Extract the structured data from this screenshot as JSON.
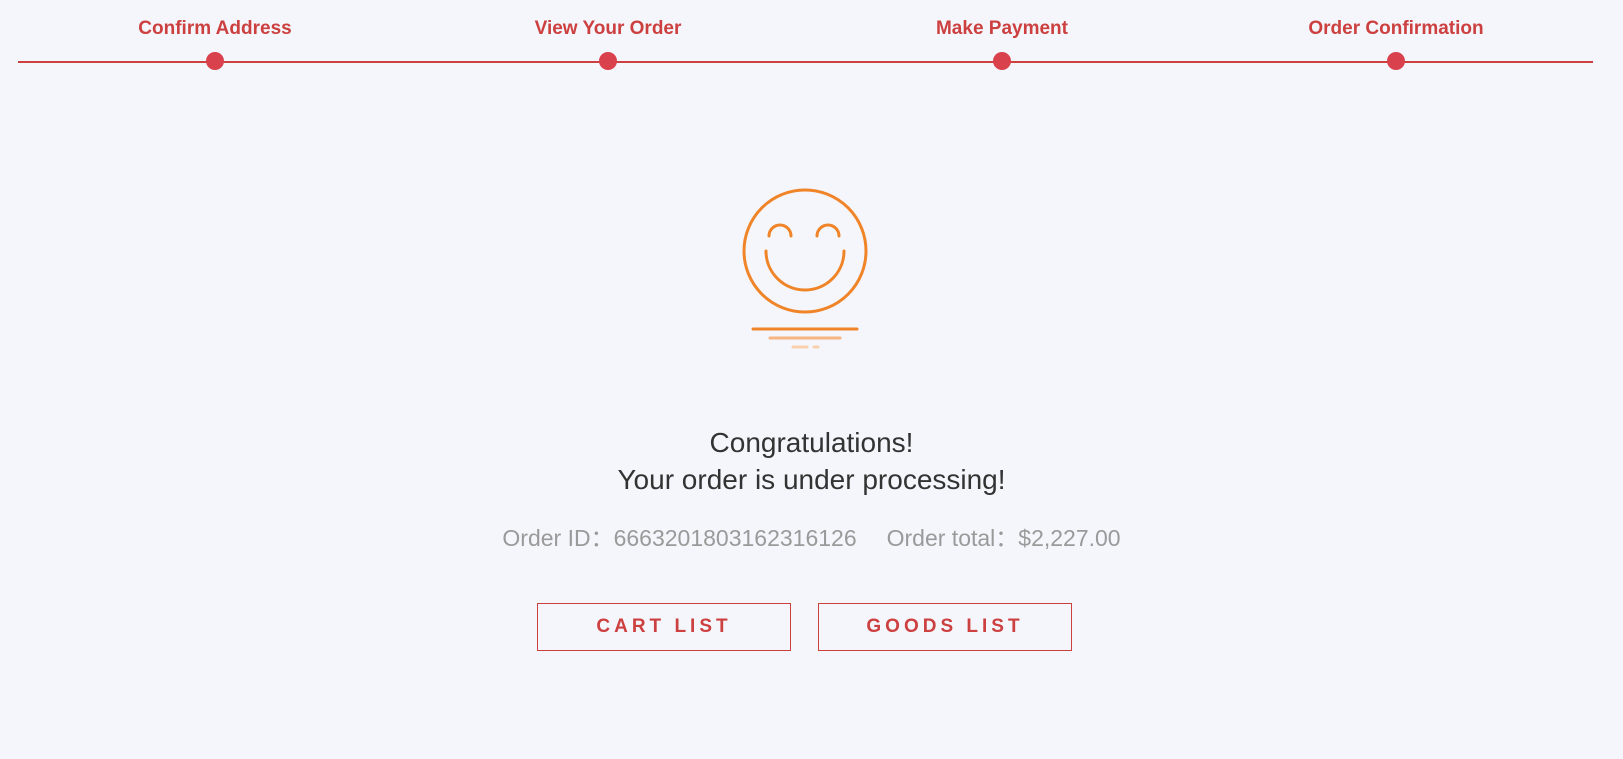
{
  "stepper": {
    "steps": [
      {
        "label": "Confirm Address"
      },
      {
        "label": "View Your Order"
      },
      {
        "label": "Make Payment"
      },
      {
        "label": "Order Confirmation"
      }
    ]
  },
  "illustration": {
    "icon": "smiley-face-icon",
    "color": "#f08428"
  },
  "result": {
    "line1": "Congratulations!",
    "line2": "Your order is under processing!"
  },
  "order": {
    "id_label": "Order ID：",
    "id_value": "6663201803162316126",
    "total_label": "Order total：",
    "total_value": "$2,227.00"
  },
  "actions": {
    "cart_label": "CART LIST",
    "goods_label": "GOODS LIST"
  },
  "colors": {
    "accent": "#cc4040",
    "dot": "#d9414d",
    "background": "#f5f6fb",
    "illustration": "#f08428"
  }
}
